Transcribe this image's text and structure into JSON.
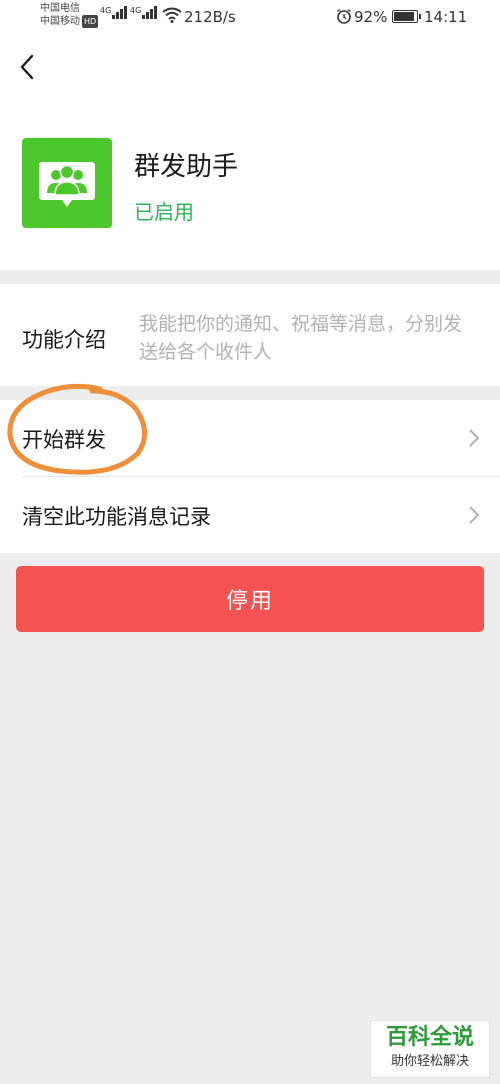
{
  "status_bar": {
    "carrier1": "中国电信",
    "carrier2": "中国移动",
    "hd": "HD",
    "net1": "4G",
    "net2": "4G",
    "speed": "212B/s",
    "battery": "92%",
    "time": "14:11"
  },
  "app": {
    "name": "群发助手",
    "status": "已启用",
    "icon": "group-chat-icon",
    "accent": "#4cc72c"
  },
  "intro": {
    "label": "功能介绍",
    "text": "我能把你的通知、祝福等消息，分别发送给各个收件人"
  },
  "list": {
    "items": [
      {
        "label": "开始群发"
      },
      {
        "label": "清空此功能消息记录"
      }
    ]
  },
  "actions": {
    "disable_label": "停用",
    "disable_color": "#f55252"
  },
  "watermark": {
    "title": "百科全说",
    "subtitle": "助你轻松解决"
  }
}
